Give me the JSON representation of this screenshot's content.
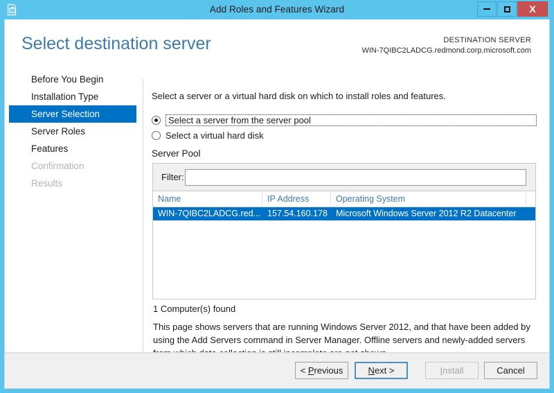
{
  "window": {
    "title": "Add Roles and Features Wizard",
    "app_icon": "wizard-briefcase-icon",
    "minimize_label": "Minimize",
    "maximize_label": "Maximize",
    "close_label": "X",
    "titlebar_color": "#5BC4EC",
    "accent_color": "#0072C6"
  },
  "header": {
    "page_title": "Select destination server",
    "destination_label": "DESTINATION SERVER",
    "destination_server": "WIN-7QIBC2LADCG.redmond.corp.microsoft.com",
    "title_color": "#3F7BA9"
  },
  "sidebar": {
    "items": [
      {
        "label": "Before You Begin",
        "state": "normal"
      },
      {
        "label": "Installation Type",
        "state": "normal"
      },
      {
        "label": "Server Selection",
        "state": "selected"
      },
      {
        "label": "Server Roles",
        "state": "normal"
      },
      {
        "label": "Features",
        "state": "normal"
      },
      {
        "label": "Confirmation",
        "state": "disabled"
      },
      {
        "label": "Results",
        "state": "disabled"
      }
    ]
  },
  "main": {
    "intro_text": "Select a server or a virtual hard disk on which to install roles and features.",
    "radios": [
      {
        "label": "Select a server from the server pool",
        "checked": true,
        "focused": true
      },
      {
        "label": "Select a virtual hard disk",
        "checked": false,
        "focused": false
      }
    ],
    "pool_caption": "Server Pool",
    "filter_label": "Filter:",
    "filter_value": "",
    "filter_placeholder": "",
    "columns": [
      "Name",
      "IP Address",
      "Operating System"
    ],
    "rows": [
      {
        "name": "WIN-7QIBC2LADCG.red...",
        "ip_address": "157.54.160.178",
        "operating_system": "Microsoft Windows Server 2012 R2 Datacenter",
        "selected": true
      }
    ],
    "found_text": "1 Computer(s) found",
    "note_text": "This page shows servers that are running Windows Server 2012, and that have been added by using the Add Servers command in Server Manager. Offline servers and newly-added servers from which data collection is still incomplete are not shown."
  },
  "footer": {
    "previous": {
      "prefix": "< ",
      "accel": "P",
      "rest": "revious"
    },
    "next": {
      "accel": "N",
      "rest": "ext >"
    },
    "install": {
      "prefix": "",
      "accel": "I",
      "rest": "nstall"
    },
    "cancel": {
      "label": "Cancel"
    }
  }
}
